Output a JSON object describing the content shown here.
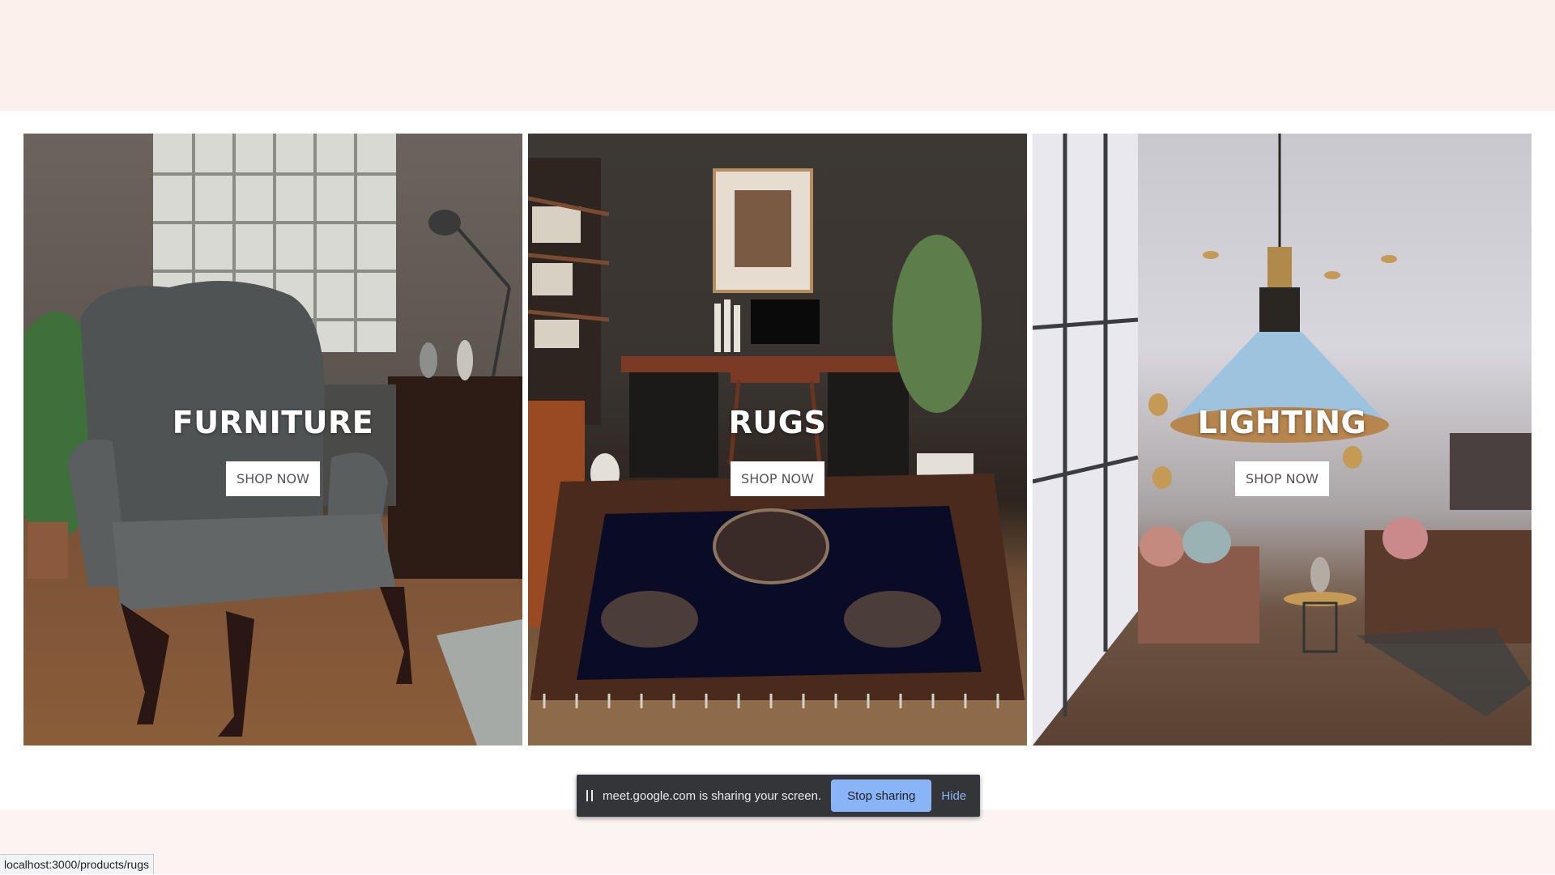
{
  "categories": [
    {
      "title": "FURNITURE",
      "button": "SHOP NOW",
      "image": "armchair-photo"
    },
    {
      "title": "RUGS",
      "button": "SHOP NOW",
      "image": "rug-photo"
    },
    {
      "title": "LIGHTING",
      "button": "SHOP NOW",
      "image": "pendant-lamp-photo"
    }
  ],
  "sharebar": {
    "message": "meet.google.com is sharing your screen.",
    "stop_label": "Stop sharing",
    "hide_label": "Hide",
    "accent": "#8ab4f8"
  },
  "status_url": "localhost:3000/products/rugs",
  "colors": {
    "top_band": "#fbf0ec",
    "sharebar_bg": "#333538"
  }
}
